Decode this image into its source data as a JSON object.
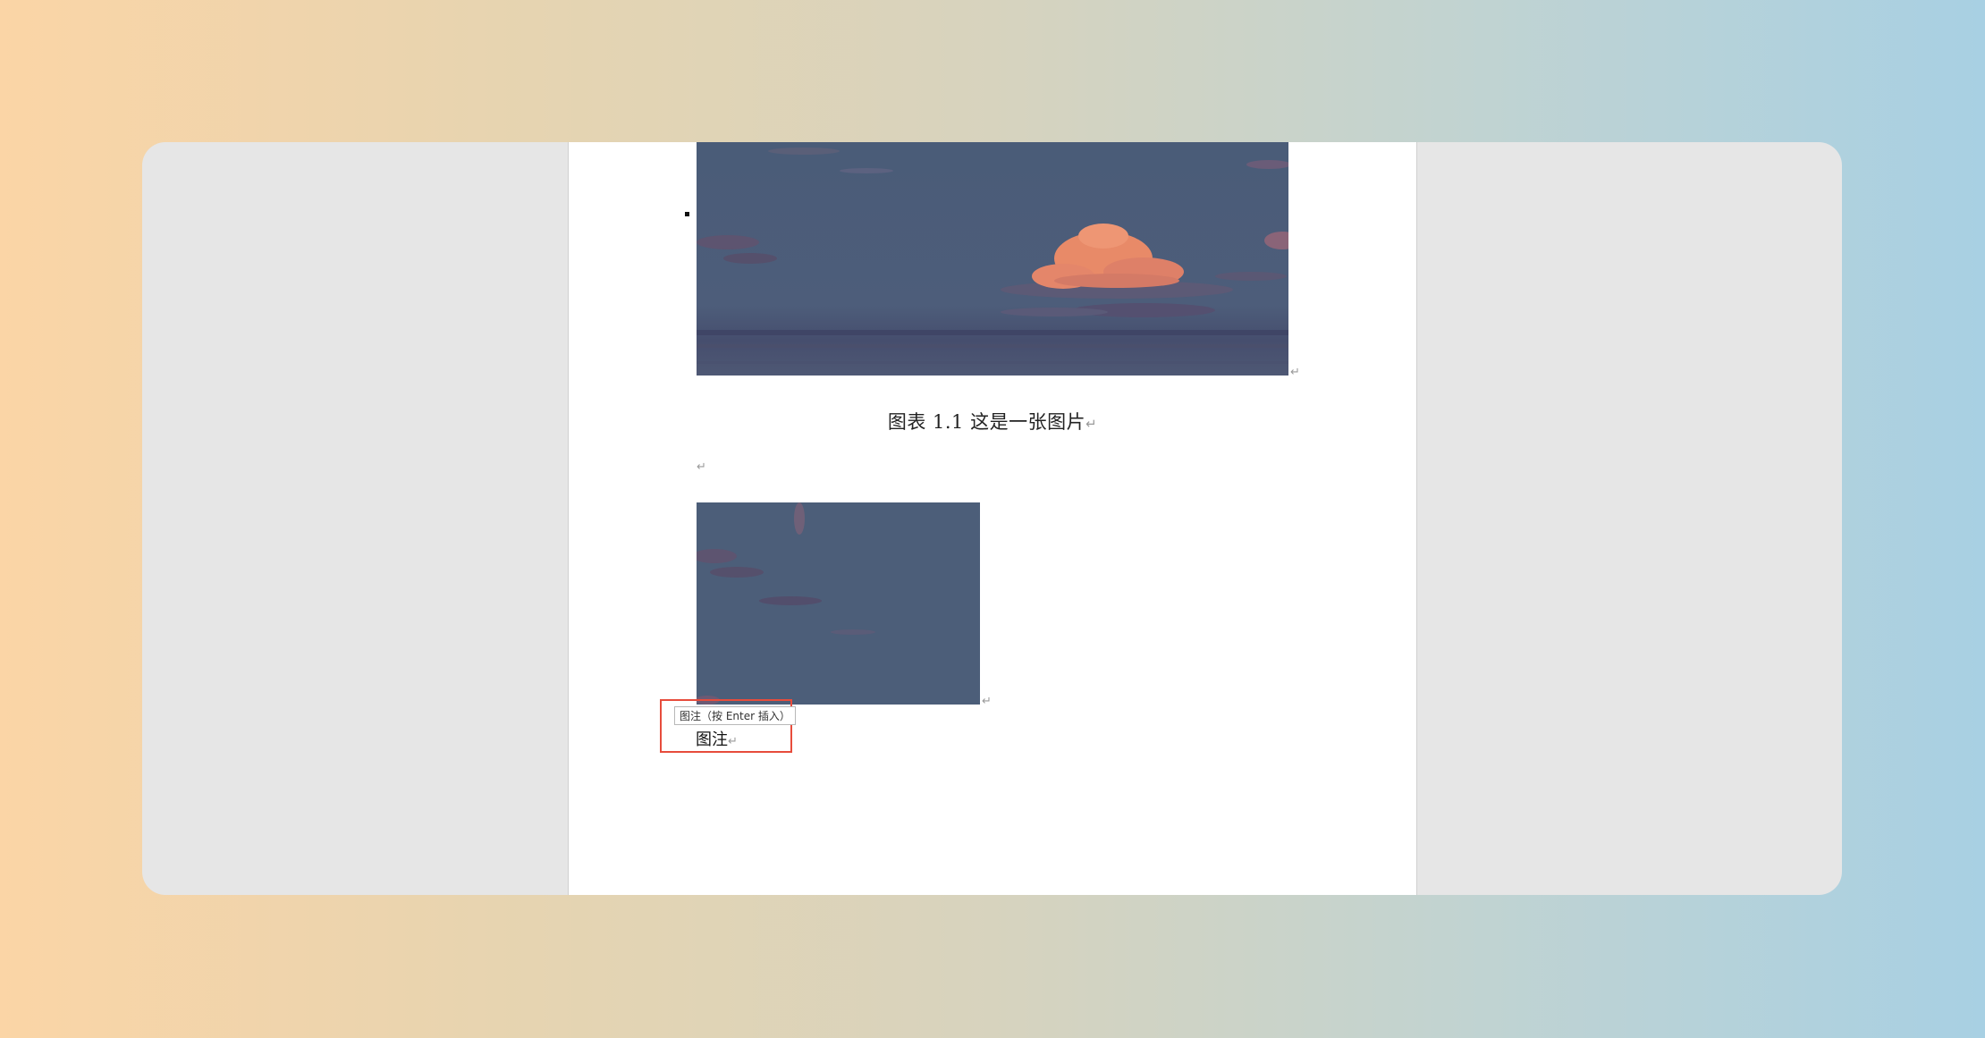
{
  "document": {
    "figure_caption": "图表  1.1  这是一张图片",
    "paragraph_mark": "↵",
    "caption_hint": "图注（按 Enter 插入）",
    "caption_input": "图注"
  },
  "colors": {
    "sky": "#4c5e79",
    "cloud_highlight": "#e88a68",
    "highlight_box": "#e74c3c",
    "canvas": "#e6e6e6",
    "page": "#ffffff"
  }
}
